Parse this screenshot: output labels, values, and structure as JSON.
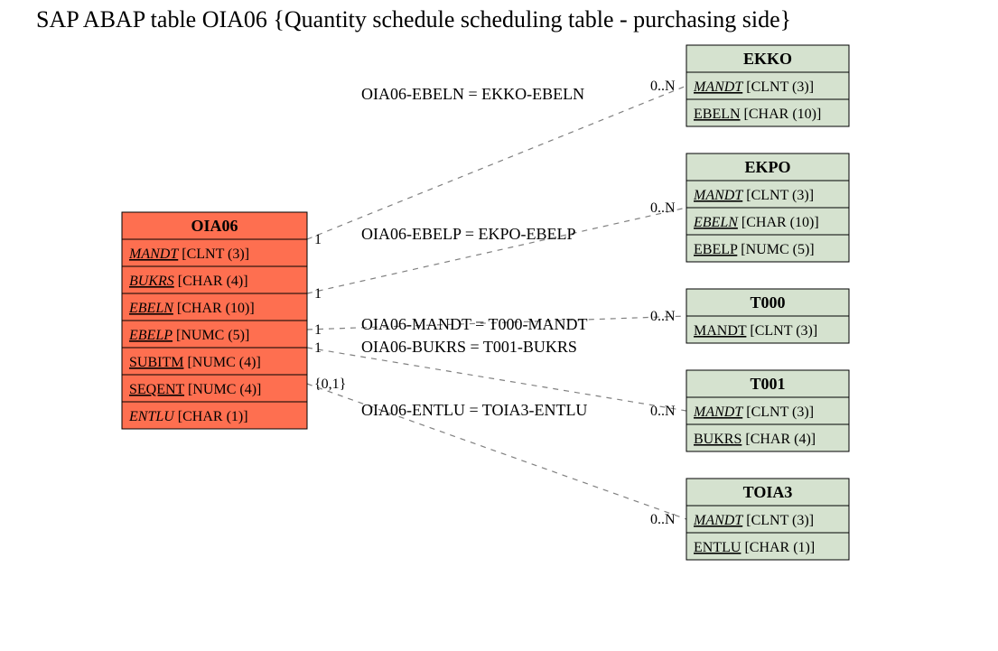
{
  "title": "SAP ABAP table OIA06 {Quantity schedule scheduling table - purchasing side}",
  "mainTable": {
    "name": "OIA06",
    "color": "#fe6f50",
    "fields": [
      {
        "name": "MANDT",
        "type": "[CLNT (3)]",
        "underline": true,
        "italic": true
      },
      {
        "name": "BUKRS",
        "type": "[CHAR (4)]",
        "underline": true,
        "italic": true
      },
      {
        "name": "EBELN",
        "type": "[CHAR (10)]",
        "underline": true,
        "italic": true
      },
      {
        "name": "EBELP",
        "type": "[NUMC (5)]",
        "underline": true,
        "italic": true
      },
      {
        "name": "SUBITM",
        "type": "[NUMC (4)]",
        "underline": true,
        "italic": false
      },
      {
        "name": "SEQENT",
        "type": "[NUMC (4)]",
        "underline": true,
        "italic": false
      },
      {
        "name": "ENTLU",
        "type": "[CHAR (1)]",
        "underline": false,
        "italic": true
      }
    ]
  },
  "refTables": [
    {
      "name": "EKKO",
      "color": "#d5e2cf",
      "fields": [
        {
          "name": "MANDT",
          "type": "[CLNT (3)]",
          "underline": true,
          "italic": true
        },
        {
          "name": "EBELN",
          "type": "[CHAR (10)]",
          "underline": true,
          "italic": false
        }
      ]
    },
    {
      "name": "EKPO",
      "color": "#d5e2cf",
      "fields": [
        {
          "name": "MANDT",
          "type": "[CLNT (3)]",
          "underline": true,
          "italic": true
        },
        {
          "name": "EBELN",
          "type": "[CHAR (10)]",
          "underline": true,
          "italic": true
        },
        {
          "name": "EBELP",
          "type": "[NUMC (5)]",
          "underline": true,
          "italic": false
        }
      ]
    },
    {
      "name": "T000",
      "color": "#d5e2cf",
      "fields": [
        {
          "name": "MANDT",
          "type": "[CLNT (3)]",
          "underline": true,
          "italic": false
        }
      ]
    },
    {
      "name": "T001",
      "color": "#d5e2cf",
      "fields": [
        {
          "name": "MANDT",
          "type": "[CLNT (3)]",
          "underline": true,
          "italic": true
        },
        {
          "name": "BUKRS",
          "type": "[CHAR (4)]",
          "underline": true,
          "italic": false
        }
      ]
    },
    {
      "name": "TOIA3",
      "color": "#d5e2cf",
      "fields": [
        {
          "name": "MANDT",
          "type": "[CLNT (3)]",
          "underline": true,
          "italic": true
        },
        {
          "name": "ENTLU",
          "type": "[CHAR (1)]",
          "underline": true,
          "italic": false
        }
      ]
    }
  ],
  "relations": [
    {
      "label": "OIA06-EBELN = EKKO-EBELN",
      "leftCard": "1",
      "rightCard": "0..N"
    },
    {
      "label": "OIA06-EBELP = EKPO-EBELP",
      "leftCard": "1",
      "rightCard": "0..N"
    },
    {
      "label": "OIA06-MANDT = T000-MANDT",
      "leftCard": "1",
      "rightCard": "0..N"
    },
    {
      "label": "OIA06-BUKRS = T001-BUKRS",
      "leftCard": "1",
      "rightCard": "0..N"
    },
    {
      "label": "OIA06-ENTLU = TOIA3-ENTLU",
      "leftCard": "{0,1}",
      "rightCard": "0..N"
    }
  ],
  "chart_data": {
    "type": "table",
    "description": "Entity-relationship diagram showing SAP ABAP table OIA06 and its foreign-key relationships to five reference tables.",
    "entities": [
      {
        "name": "OIA06",
        "role": "main",
        "fields": [
          "MANDT CLNT(3)",
          "BUKRS CHAR(4)",
          "EBELN CHAR(10)",
          "EBELP NUMC(5)",
          "SUBITM NUMC(4)",
          "SEQENT NUMC(4)",
          "ENTLU CHAR(1)"
        ]
      },
      {
        "name": "EKKO",
        "role": "ref",
        "fields": [
          "MANDT CLNT(3)",
          "EBELN CHAR(10)"
        ]
      },
      {
        "name": "EKPO",
        "role": "ref",
        "fields": [
          "MANDT CLNT(3)",
          "EBELN CHAR(10)",
          "EBELP NUMC(5)"
        ]
      },
      {
        "name": "T000",
        "role": "ref",
        "fields": [
          "MANDT CLNT(3)"
        ]
      },
      {
        "name": "T001",
        "role": "ref",
        "fields": [
          "MANDT CLNT(3)",
          "BUKRS CHAR(4)"
        ]
      },
      {
        "name": "TOIA3",
        "role": "ref",
        "fields": [
          "MANDT CLNT(3)",
          "ENTLU CHAR(1)"
        ]
      }
    ],
    "relationships": [
      {
        "from": "OIA06.EBELN",
        "to": "EKKO.EBELN",
        "fromCard": "1",
        "toCard": "0..N"
      },
      {
        "from": "OIA06.EBELP",
        "to": "EKPO.EBELP",
        "fromCard": "1",
        "toCard": "0..N"
      },
      {
        "from": "OIA06.MANDT",
        "to": "T000.MANDT",
        "fromCard": "1",
        "toCard": "0..N"
      },
      {
        "from": "OIA06.BUKRS",
        "to": "T001.BUKRS",
        "fromCard": "1",
        "toCard": "0..N"
      },
      {
        "from": "OIA06.ENTLU",
        "to": "TOIA3.ENTLU",
        "fromCard": "{0,1}",
        "toCard": "0..N"
      }
    ]
  }
}
